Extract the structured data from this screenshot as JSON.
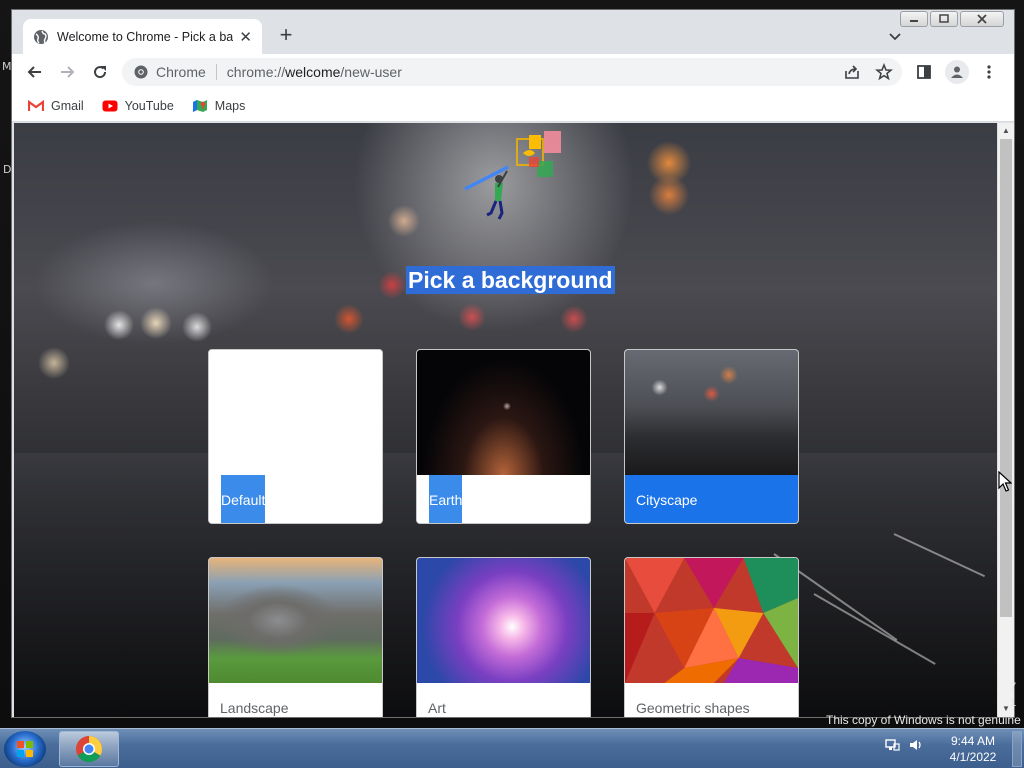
{
  "desktop": {
    "left_letters": [
      "M",
      "D"
    ],
    "genuine_text": "This copy of Windows is not genuine",
    "build_text": [
      "7",
      "1"
    ]
  },
  "browser": {
    "tab": {
      "title": "Welcome to Chrome - Pick a bac",
      "close_icon": "close-icon",
      "favicon": "globe-icon"
    },
    "new_tab_label": "+",
    "window_controls": [
      "minimize",
      "maximize",
      "close"
    ],
    "omnibox": {
      "site_label": "Chrome",
      "url_prefix": "chrome://",
      "url_host": "welcome",
      "url_path": "/new-user"
    },
    "bookmarks": [
      {
        "label": "Gmail",
        "icon": "gmail-icon"
      },
      {
        "label": "YouTube",
        "icon": "youtube-icon"
      },
      {
        "label": "Maps",
        "icon": "maps-icon"
      }
    ]
  },
  "page": {
    "heading": "Pick a background",
    "backgrounds": [
      {
        "label": "Default",
        "selected": false
      },
      {
        "label": "Earth",
        "selected": false
      },
      {
        "label": "Cityscape",
        "selected": true
      },
      {
        "label": "Landscape",
        "selected": false
      },
      {
        "label": "Art",
        "selected": false
      },
      {
        "label": "Geometric shapes",
        "selected": false
      }
    ],
    "accent_color": "#1a73e8"
  },
  "taskbar": {
    "time": "9:44 AM",
    "date": "4/1/2022",
    "pinned": [
      "chrome-icon"
    ]
  }
}
